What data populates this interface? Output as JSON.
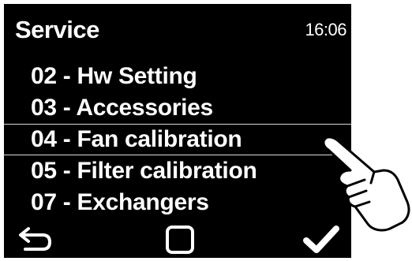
{
  "header": {
    "title": "Service",
    "time": "16:06"
  },
  "menu": {
    "items": [
      {
        "label": "02 - Hw Setting",
        "selected": false
      },
      {
        "label": "03 - Accessories",
        "selected": false
      },
      {
        "label": "04 - Fan calibration",
        "selected": true
      },
      {
        "label": "05 - Filter calibration",
        "selected": false
      },
      {
        "label": "07 - Exchangers",
        "selected": false
      }
    ]
  },
  "footer": {
    "back_icon": "return-arrow-icon",
    "home_icon": "square-icon",
    "confirm_icon": "checkmark-icon"
  },
  "colors": {
    "screen_background": "#000000",
    "text": "#ffffff",
    "selection_lines": "#d8d8d8"
  }
}
